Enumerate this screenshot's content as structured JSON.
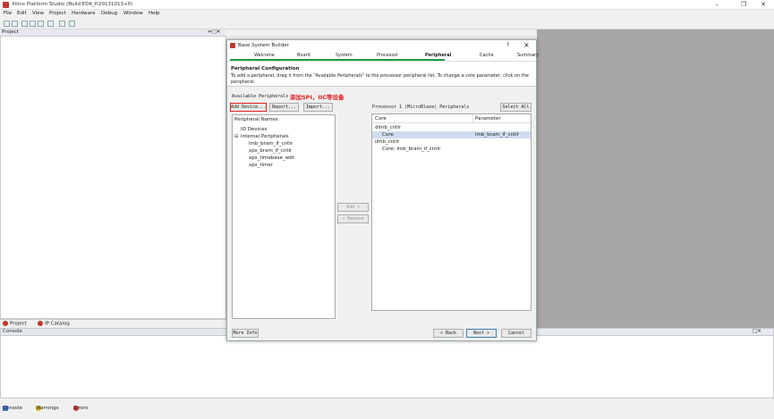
{
  "window": {
    "title": "Xilinx Platform Studio (Build EDK_P.20131013+0)"
  },
  "menu": [
    "File",
    "Edit",
    "View",
    "Project",
    "Hardware",
    "Debug",
    "Window",
    "Help"
  ],
  "project_panel": {
    "title": "Project"
  },
  "dialog": {
    "title": "Base System Builder",
    "help": "?",
    "close": "×",
    "steps": [
      "Welcome",
      "Board",
      "System",
      "Processor",
      "Peripheral",
      "Cache",
      "Summary"
    ],
    "active_step": "Peripheral",
    "heading": "Peripheral Configuration",
    "description": "To add a peripheral, drag it from the \"Available Peripherals\" to the processor peripheral list. To change a core parameter, click on the peripheral.",
    "available_label": "Available Peripherals",
    "annotation": "添加SPI，IIC等设备",
    "buttons": {
      "add_device": "Add Device...",
      "report": "Report...",
      "import": "Import...",
      "add": "Add >",
      "remove": "< Remove",
      "select_all": "Select All",
      "more_info": "More Info",
      "back": "< Back",
      "next": "Next >",
      "cancel": "Cancel"
    },
    "available_tree": {
      "root": "Peripheral Names",
      "io": "IO Devices",
      "internal": "Internal Peripherals",
      "items": [
        "lmb_bram_if_cntlr",
        "xps_bram_if_cntlr",
        "xps_timebase_wdt",
        "xps_timer"
      ]
    },
    "processor_label": "Processor 1 (MicroBlaze) Peripherals",
    "processor_table": {
      "columns": [
        "Core",
        "Parameter"
      ],
      "rows": [
        {
          "core": "dlmb_cntlr",
          "param": ""
        },
        {
          "core": "Core",
          "param": "lmb_bram_if_cntlr"
        },
        {
          "core": "ilmb_cntlr",
          "param": ""
        },
        {
          "core": "Core: lmb_bram_if_cntlr",
          "param": ""
        }
      ]
    }
  },
  "bottom_tabs": [
    "Project",
    "IP Catalog"
  ],
  "console": {
    "title": "Console"
  },
  "status_tabs": [
    "Console",
    "Warnings",
    "Errors"
  ],
  "colors": {
    "accent": "#1c9e3a",
    "annotation": "#e02020",
    "highlight": "#cfdcee"
  }
}
